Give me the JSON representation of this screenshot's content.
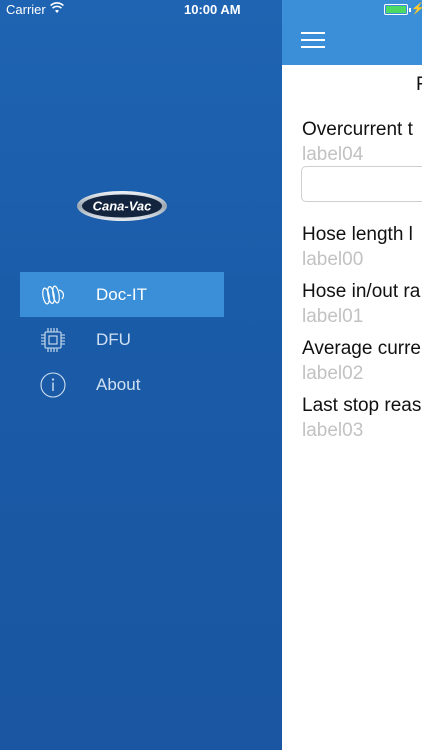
{
  "status_bar": {
    "carrier": "Carrier",
    "time": "10:00 AM"
  },
  "drawer": {
    "logo_text": "Cana-Vac",
    "items": [
      {
        "label": "Doc-IT",
        "icon": "docit-icon",
        "active": true
      },
      {
        "label": "DFU",
        "icon": "chip-icon",
        "active": false
      },
      {
        "label": "About",
        "icon": "info-icon",
        "active": false
      }
    ]
  },
  "content": {
    "partial_title": "F",
    "fields": [
      {
        "title": "Overcurrent t",
        "value": "label04"
      },
      {
        "title": "Hose length l",
        "value": "label00"
      },
      {
        "title": "Hose in/out ra",
        "value": "label01"
      },
      {
        "title": "Average curre",
        "value": "label02"
      },
      {
        "title": "Last stop reas",
        "value": "label03"
      }
    ]
  },
  "colors": {
    "drawer_bg": "#1a5aa5",
    "accent": "#3b8fd8",
    "battery": "#4cd964"
  }
}
